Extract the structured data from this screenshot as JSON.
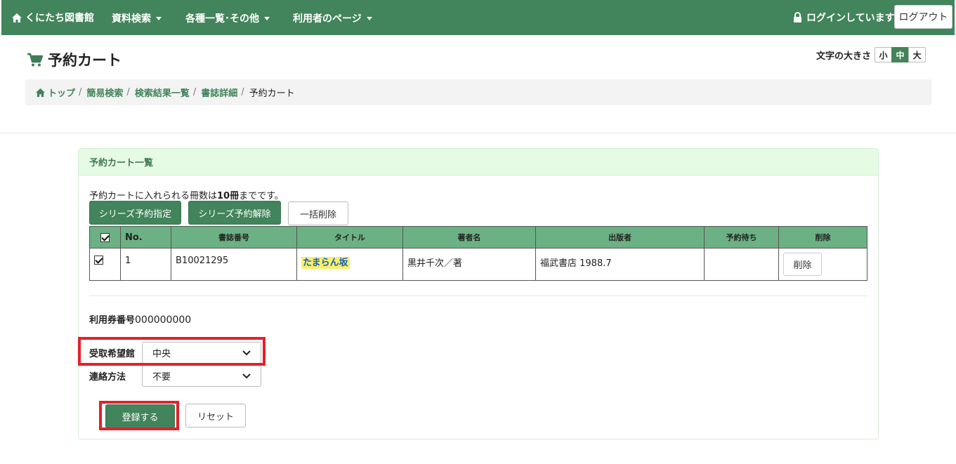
{
  "nav": {
    "brand": "くにたち図書館",
    "menus": [
      "資料検索",
      "各種一覧･その他",
      "利用者のページ"
    ],
    "login_status": "ログインしています",
    "logout_label": "ログアウト"
  },
  "header": {
    "title": "予約カート",
    "font_size_label": "文字の大きさ",
    "font_sizes": [
      "小",
      "中",
      "大"
    ],
    "font_size_active": "中"
  },
  "breadcrumb": {
    "items": [
      "トップ",
      "簡易検索",
      "検索結果一覧",
      "書誌詳細"
    ],
    "current": "予約カート"
  },
  "panel": {
    "heading": "予約カート一覧",
    "note_prefix": "予約カートに入れられる冊数は",
    "note_count": "10冊",
    "note_suffix": "までです。",
    "btn_series_set": "シリーズ予約指定",
    "btn_series_unset": "シリーズ予約解除",
    "btn_bulk_delete": "一括削除"
  },
  "table": {
    "headers": [
      "No.",
      "書誌番号",
      "タイトル",
      "著者名",
      "出版者",
      "予約待ち",
      "削除"
    ],
    "rows": [
      {
        "checked": true,
        "no": "1",
        "id": "B10021295",
        "title": "たまらん坂",
        "author": "黒井千次／著",
        "publisher": "福武書店 1988.7",
        "waiting": "",
        "delete_label": "削除"
      }
    ]
  },
  "form": {
    "card_label": "利用券番号",
    "card_value": "000000000",
    "pickup_label": "受取希望館",
    "pickup_value": "中央",
    "contact_label": "連絡方法",
    "contact_value": "不要",
    "submit_label": "登録する",
    "reset_label": "リセット"
  },
  "colors": {
    "nav": "#42845b",
    "table_header": "#6cb184",
    "panel_head": "#e6fbe4",
    "highlight": "#e5202a"
  }
}
